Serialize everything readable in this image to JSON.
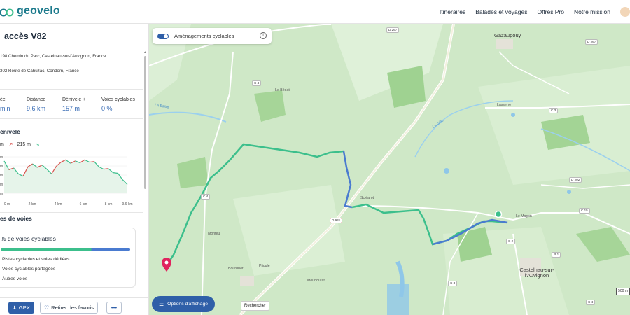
{
  "header": {
    "logo_text": "geovelo",
    "nav": [
      "Itinéraires",
      "Balades et voyages",
      "Offres Pro",
      "Notre mission"
    ]
  },
  "sidebar": {
    "title": "accès V82",
    "origin_address": "198 Chemin du Parc, Castelnau-sur-l'Auvignon, France",
    "destination_address": "302 Route de Cahuzac, Condom, France",
    "stats": [
      {
        "label": "ée",
        "value": "min"
      },
      {
        "label": "Distance",
        "value": "9,6 km"
      },
      {
        "label": "Dénivelé +",
        "value": "157 m"
      },
      {
        "label": "Voies cyclables",
        "value": "0 %"
      }
    ],
    "elevation": {
      "section_title": "énivelé",
      "min_label": "m",
      "max_label": "215 m",
      "y_tick_labels": [
        "m",
        "m",
        "m",
        "m",
        "m"
      ],
      "x_tick_labels": [
        "0 m",
        "2 km",
        "4 km",
        "6 km",
        "8 km",
        "9.6 km"
      ],
      "profile": [
        210,
        195,
        198,
        188,
        184,
        200,
        205,
        199,
        203,
        196,
        188,
        201,
        208,
        212,
        206,
        210,
        207,
        212,
        208,
        209,
        200,
        196,
        197,
        190,
        189,
        178,
        170
      ]
    },
    "voies": {
      "section_title": "es de voies",
      "card_title": "% de voies cyclables",
      "legend": [
        "Pistes cyclables et voies dédiées",
        "Voies cyclables partagées",
        "Autres voies"
      ]
    },
    "buttons": {
      "gpx": "GPX",
      "favorite": "Retirer des favoris",
      "more": "•••"
    }
  },
  "map": {
    "layer_toggle_label": "Aménagements cyclables",
    "options_label": "Options d'affichage",
    "search_label": "Rechercher",
    "scale_label": "500 m",
    "places": [
      {
        "name": "Gazaupouy",
        "big": true
      },
      {
        "name": "Le Bédat"
      },
      {
        "name": "Lasserre"
      },
      {
        "name": "Le Maçon"
      },
      {
        "name": "Sciéarot"
      },
      {
        "name": "Monteu"
      },
      {
        "name": "Bourdillet"
      },
      {
        "name": "Pijoulé"
      },
      {
        "name": "Meuhourat"
      },
      {
        "name": "Castelnau-sur-l'Auvignon",
        "big": true
      },
      {
        "name": "La Baïse"
      },
      {
        "name": "La Gèle"
      }
    ],
    "roads": [
      "D 267",
      "D 267",
      "C 3",
      "C 4",
      "C 4",
      "D 931",
      "C 2",
      "C 15",
      "D 202",
      "R 1",
      "C 3",
      "C 4"
    ],
    "colors": {
      "route_green": "#3cbf8c",
      "route_blue": "#4a7bd0",
      "brand": "#2f5fa8",
      "origin_pin": "#e0245e"
    }
  }
}
